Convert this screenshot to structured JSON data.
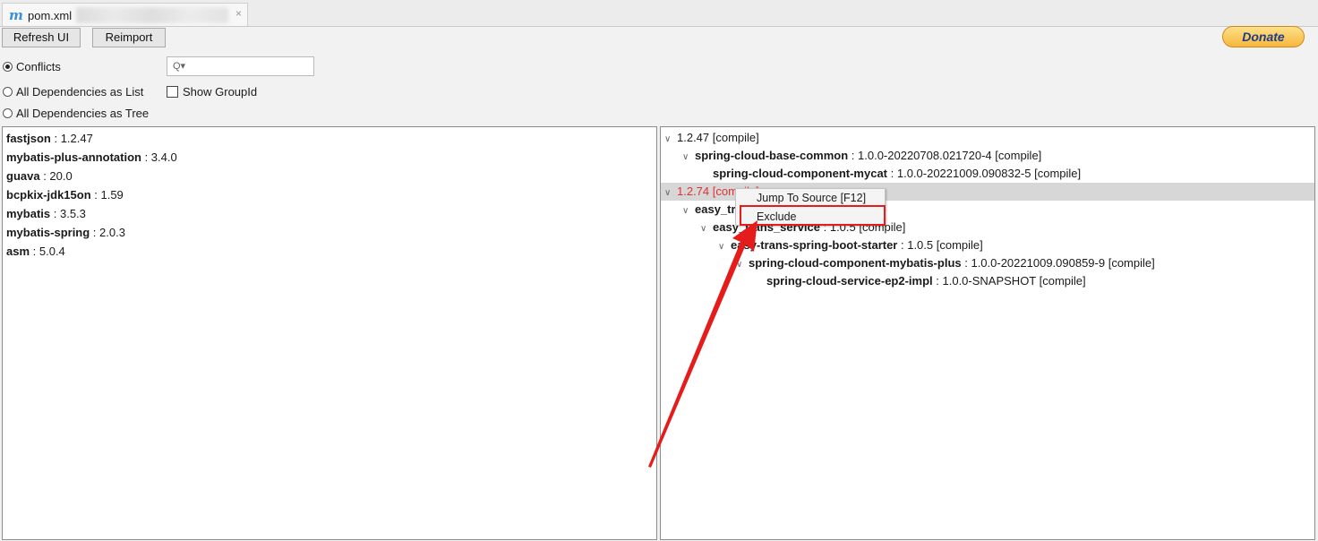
{
  "tab": {
    "icon": "m",
    "label": "pom.xml",
    "close": "×"
  },
  "toolbar": {
    "refresh": "Refresh UI",
    "reimport": "Reimport",
    "donate": "Donate"
  },
  "modes": {
    "conflicts": "Conflicts",
    "list": "All Dependencies as List",
    "tree": "All Dependencies as Tree",
    "selected": "conflicts"
  },
  "search": {
    "icon": "Q▾",
    "value": ""
  },
  "show_groupid": {
    "label": "Show GroupId",
    "checked": false
  },
  "conflicts": [
    {
      "name": "fastjson",
      "sep": " : ",
      "version": "1.2.47"
    },
    {
      "name": "mybatis-plus-annotation",
      "sep": " : ",
      "version": "3.4.0"
    },
    {
      "name": "guava",
      "sep": " : ",
      "version": "20.0"
    },
    {
      "name": "bcpkix-jdk15on",
      "sep": " : ",
      "version": "1.59"
    },
    {
      "name": "mybatis",
      "sep": " : ",
      "version": "3.5.3"
    },
    {
      "name": "mybatis-spring",
      "sep": " : ",
      "version": "2.0.3"
    },
    {
      "name": "asm",
      "sep": " : ",
      "version": "5.0.4"
    }
  ],
  "tree": [
    {
      "chev": "∨",
      "name": "",
      "text": "1.2.47 [compile]",
      "red": false
    },
    {
      "chev": "∨",
      "name": "spring-cloud-base-common",
      "text": " : 1.0.0-20220708.021720-4 [compile]",
      "red": false
    },
    {
      "chev": "",
      "name": "spring-cloud-component-mycat",
      "text": " : 1.0.0-20221009.090832-5 [compile]",
      "red": false
    },
    {
      "chev": "∨",
      "name": "",
      "text": "1.2.74 [compile]",
      "red": true
    },
    {
      "chev": "∨",
      "name": "easy_trans",
      "text": "",
      "red": false
    },
    {
      "chev": "∨",
      "name": "easy_trans_service",
      "text": " : 1.0.5 [compile]",
      "red": false
    },
    {
      "chev": "∨",
      "name": "easy-trans-spring-boot-starter",
      "text": " : 1.0.5 [compile]",
      "red": false
    },
    {
      "chev": "∨",
      "name": "spring-cloud-component-mybatis-plus",
      "text": " : 1.0.0-20221009.090859-9 [compile]",
      "red": false
    },
    {
      "chev": "",
      "name": "spring-cloud-service-ep2-impl",
      "text": " : 1.0.0-SNAPSHOT [compile]",
      "red": false
    }
  ],
  "context_menu": {
    "jump": "Jump To Source [F12]",
    "exclude": "Exclude"
  },
  "annotation": {
    "color": "#e41c1c",
    "arrow_icon": "red-arrow-icon"
  }
}
